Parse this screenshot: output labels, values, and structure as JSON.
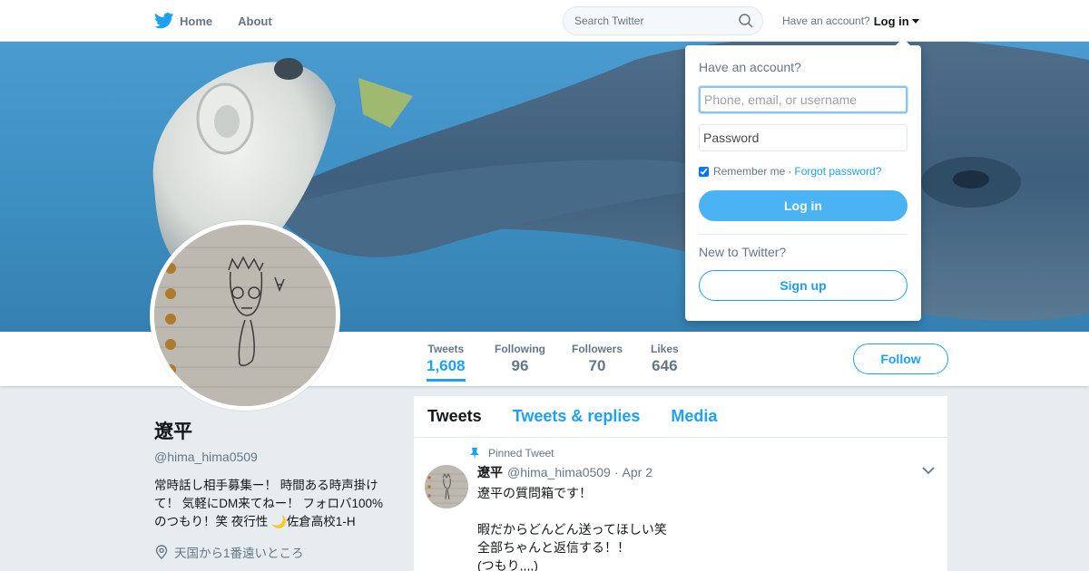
{
  "nav": {
    "home_label": "Home",
    "about_label": "About",
    "search_placeholder": "Search Twitter",
    "have_account": "Have an account?",
    "login_label": "Log in"
  },
  "profile": {
    "name": "遼平",
    "handle": "@hima_hima0509",
    "bio": "常時話し相手募集ー！ 時間ある時声掛けて！ 気軽にDM来てねー！ フォロバ100%のつもり！笑 夜行性 🌙佐倉高校1-H",
    "location": "天国から1番遠いところ"
  },
  "stats": [
    {
      "label": "Tweets",
      "value": "1,608"
    },
    {
      "label": "Following",
      "value": "96"
    },
    {
      "label": "Followers",
      "value": "70"
    },
    {
      "label": "Likes",
      "value": "646"
    }
  ],
  "follow_label": "Follow",
  "tabs": [
    "Tweets",
    "Tweets & replies",
    "Media"
  ],
  "pinned_tweet": {
    "pinned_label": "Pinned Tweet",
    "name": "遼平",
    "handle": "@hima_hima0509",
    "dot": "·",
    "date": "Apr 2",
    "lines": [
      "遼平の質問箱です！",
      "",
      "暇だからどんどん送ってほしい笑",
      "全部ちゃんと返信する！！",
      "(つもり,,,,)"
    ]
  },
  "login_dropdown": {
    "title": "Have an account?",
    "username_placeholder": "Phone, email, or username",
    "password_placeholder": "Password",
    "remember_label": "Remember me",
    "separator": "·",
    "forgot_label": "Forgot password?",
    "login_button": "Log in",
    "new_label": "New to Twitter?",
    "signup_button": "Sign up"
  },
  "colors": {
    "accent": "#1da1f2",
    "button_blue": "#4ab3f4",
    "banner_water": "#3f8fbd"
  },
  "icons": [
    "twitter-bird-icon",
    "home-icon",
    "search-icon",
    "location-icon",
    "pin-icon",
    "chevron-down-icon"
  ]
}
